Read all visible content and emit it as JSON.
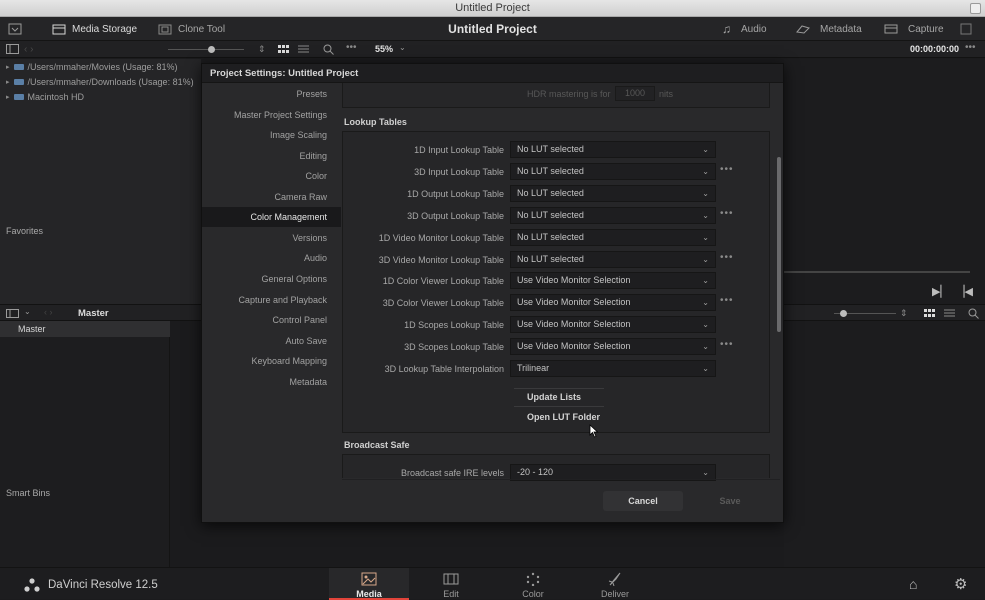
{
  "window": {
    "title": "Untitled Project"
  },
  "topbar": {
    "media_storage": "Media Storage",
    "clone_tool": "Clone Tool",
    "project_title": "Untitled Project",
    "audio": "Audio",
    "metadata": "Metadata",
    "capture": "Capture"
  },
  "toolbar": {
    "zoom": "55%",
    "timecode": "00:00:00:00"
  },
  "media_tree": [
    {
      "label": "/Users/mmaher/Movies (Usage: 81%)"
    },
    {
      "label": "/Users/mmaher/Downloads (Usage: 81%)"
    },
    {
      "label": "Macintosh HD"
    }
  ],
  "left": {
    "favorites": "Favorites",
    "master_header": "Master",
    "master_item": "Master",
    "smart_bins": "Smart Bins"
  },
  "dialog": {
    "title": "Project Settings:  Untitled Project",
    "nav": [
      "Presets",
      "Master Project Settings",
      "Image Scaling",
      "Editing",
      "Color",
      "Camera Raw",
      "Color Management",
      "Versions",
      "Audio",
      "General Options",
      "Capture and Playback",
      "Control Panel",
      "Auto Save",
      "Keyboard Mapping",
      "Metadata"
    ],
    "active_nav": "Color Management",
    "hdr": {
      "label": "HDR mastering is for",
      "value": "1000",
      "unit": "nits"
    },
    "lookup_tables": {
      "title": "Lookup Tables",
      "rows": [
        {
          "label": "1D Input Lookup Table",
          "value": "No LUT selected",
          "dots": false
        },
        {
          "label": "3D Input Lookup Table",
          "value": "No LUT selected",
          "dots": true
        },
        {
          "label": "1D Output Lookup Table",
          "value": "No LUT selected",
          "dots": false
        },
        {
          "label": "3D Output Lookup Table",
          "value": "No LUT selected",
          "dots": true
        },
        {
          "label": "1D Video Monitor Lookup Table",
          "value": "No LUT selected",
          "dots": false
        },
        {
          "label": "3D Video Monitor Lookup Table",
          "value": "No LUT selected",
          "dots": true
        },
        {
          "label": "1D Color Viewer Lookup Table",
          "value": "Use Video Monitor Selection",
          "dots": false
        },
        {
          "label": "3D Color Viewer Lookup Table",
          "value": "Use Video Monitor Selection",
          "dots": true
        },
        {
          "label": "1D Scopes Lookup Table",
          "value": "Use Video Monitor Selection",
          "dots": false
        },
        {
          "label": "3D Scopes Lookup Table",
          "value": "Use Video Monitor Selection",
          "dots": true
        },
        {
          "label": "3D Lookup Table Interpolation",
          "value": "Trilinear",
          "dots": false
        }
      ],
      "update_lists": "Update Lists",
      "open_lut_folder": "Open LUT Folder"
    },
    "broadcast_safe": {
      "title": "Broadcast Safe",
      "label": "Broadcast safe IRE levels",
      "value": "-20 - 120"
    },
    "cancel": "Cancel",
    "save": "Save"
  },
  "bottom": {
    "app_name": "DaVinci Resolve 12.5",
    "pages": [
      "Media",
      "Edit",
      "Color",
      "Deliver"
    ],
    "active_page": "Media"
  },
  "colors": {
    "accent": "#e2443a",
    "dialog_bg": "#29292b",
    "panel_bg": "#252527"
  }
}
